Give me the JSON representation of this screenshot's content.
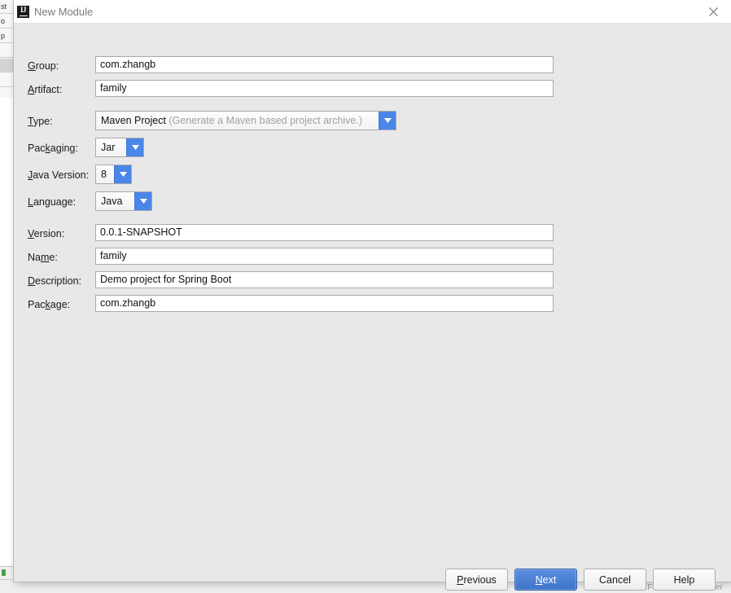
{
  "background": {
    "left_rows": [
      {
        "text": "st",
        "selected": false
      },
      {
        "text": "o",
        "selected": false
      },
      {
        "text": "p",
        "selected": false
      },
      {
        "text": "",
        "selected": false
      },
      {
        "text": "",
        "selected": true
      },
      {
        "text": "",
        "selected": false
      },
      {
        "text": "",
        "selected": false
      }
    ],
    "status_text": "LF   UTF-8   Git: master"
  },
  "dialog": {
    "title": "New Module",
    "icon": "intellij-idea-icon",
    "close_icon": "close-icon",
    "fields": [
      {
        "name": "group",
        "label_pre": "",
        "label_key": "G",
        "label_post": "roup:",
        "value": "com.zhangb"
      },
      {
        "name": "artifact",
        "label_pre": "",
        "label_key": "A",
        "label_post": "rtifact:",
        "value": "family"
      },
      {
        "name": "version",
        "label_pre": "",
        "label_key": "V",
        "label_post": "ersion:",
        "value": "0.0.1-SNAPSHOT"
      },
      {
        "name": "name",
        "label_pre": "Na",
        "label_key": "m",
        "label_post": "e:",
        "value": "family"
      },
      {
        "name": "description",
        "label_pre": "",
        "label_key": "D",
        "label_post": "escription:",
        "value": "Demo project for Spring Boot"
      },
      {
        "name": "package",
        "label_pre": "Pac",
        "label_key": "k",
        "label_post": "age:",
        "value": "com.zhangb"
      }
    ],
    "combos": [
      {
        "name": "type",
        "label_pre": "",
        "label_key": "T",
        "label_post": "ype:",
        "value": "Maven Project",
        "hint": "(Generate a Maven based project archive.)",
        "arrow_icon": "chevron-down-icon"
      },
      {
        "name": "packaging",
        "label_pre": "Pac",
        "label_key": "k",
        "label_post": "aging:",
        "value": "Jar",
        "hint": "",
        "arrow_icon": "chevron-down-icon"
      },
      {
        "name": "java-version",
        "label_pre": "",
        "label_key": "J",
        "label_post": "ava Version:",
        "value": "8",
        "hint": "",
        "arrow_icon": "chevron-down-icon"
      },
      {
        "name": "language",
        "label_pre": "",
        "label_key": "L",
        "label_post": "anguage:",
        "value": "Java",
        "hint": "",
        "arrow_icon": "chevron-down-icon"
      }
    ],
    "buttons": [
      {
        "name": "previous",
        "pre": "",
        "key": "P",
        "post": "revious",
        "primary": false
      },
      {
        "name": "next",
        "pre": "",
        "key": "N",
        "post": "ext",
        "primary": true
      },
      {
        "name": "cancel",
        "pre": "Cancel",
        "key": "",
        "post": "",
        "primary": false
      },
      {
        "name": "help",
        "pre": "Help",
        "key": "",
        "post": "",
        "primary": false
      }
    ]
  },
  "colors": {
    "accent": "#4a86e8",
    "primary_button": "#3f74ca",
    "dialog_bg": "#e8e8e8",
    "titlebar_bg": "#ffffff",
    "label_text": "#1a1a1a",
    "hint_text": "#a0a0a0"
  }
}
